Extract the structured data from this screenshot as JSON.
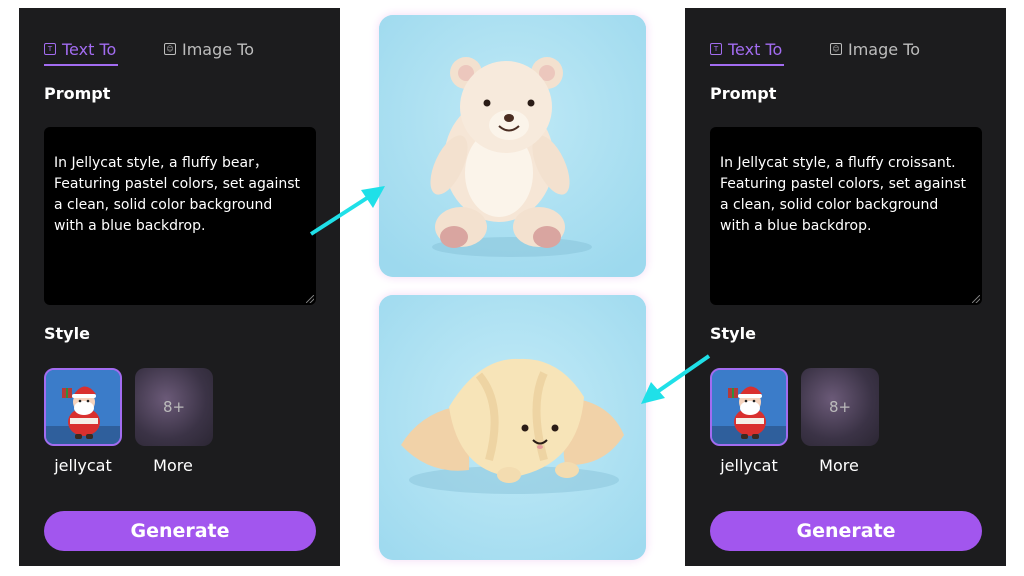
{
  "panels": [
    {
      "tabs": {
        "active": "Text To",
        "inactive": "Image To"
      },
      "prompt_label": "Prompt",
      "prompt_text": "In Jellycat style, a fluffy bear，\nFeaturing pastel colors, set against\na clean, solid color background\nwith a blue backdrop.",
      "style_label": "Style",
      "styles": [
        {
          "name": "jellycat"
        },
        {
          "name": "More",
          "count": "8+"
        }
      ],
      "generate_label": "Generate"
    },
    {
      "tabs": {
        "active": "Text To",
        "inactive": "Image To"
      },
      "prompt_label": "Prompt",
      "prompt_text": "In Jellycat style, a fluffy croissant.\nFeaturing pastel colors, set against\na clean, solid color background\nwith a blue backdrop.",
      "style_label": "Style",
      "styles": [
        {
          "name": "jellycat"
        },
        {
          "name": "More",
          "count": "8+"
        }
      ],
      "generate_label": "Generate"
    }
  ],
  "colors": {
    "accent": "#a256ee",
    "panel_bg": "#1c1c1e",
    "arrow": "#1fe0e8",
    "image_bg": "#a6dff0"
  }
}
